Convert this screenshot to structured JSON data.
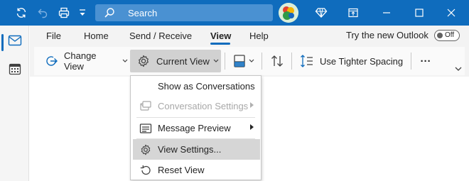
{
  "titlebar": {
    "search_placeholder": "Search",
    "icons": [
      "sync-icon",
      "undo-icon",
      "print-icon",
      "customize-qat-icon",
      "search-icon",
      "premium-diamond-icon",
      "restore-window-icon",
      "minimize-icon",
      "maximize-icon",
      "close-icon"
    ],
    "accent": "#0f6cbd"
  },
  "rail": {
    "items": [
      {
        "icon": "mail-icon",
        "selected": true
      },
      {
        "icon": "calendar-icon",
        "selected": false
      }
    ]
  },
  "ribbon": {
    "tabs": [
      {
        "label": "File"
      },
      {
        "label": "Home"
      },
      {
        "label": "Send / Receive"
      },
      {
        "label": "View",
        "active": true
      },
      {
        "label": "Help"
      }
    ],
    "try_new_outlook": "Try the new Outlook",
    "toggle_state": "Off",
    "buttons": {
      "change_view": "Change View",
      "current_view": "Current View",
      "tighter_spacing": "Use Tighter Spacing",
      "more": "···"
    }
  },
  "menu": {
    "items": [
      {
        "label": "Show as Conversations",
        "icon": "",
        "enabled": true,
        "submenu": false
      },
      {
        "label": "Conversation Settings",
        "icon": "conversation-settings-icon",
        "enabled": false,
        "submenu": true
      },
      {
        "label": "Message Preview",
        "icon": "message-preview-icon",
        "enabled": true,
        "submenu": true
      },
      {
        "label": "View Settings...",
        "icon": "gear-icon",
        "enabled": true,
        "submenu": false,
        "hovered": true
      },
      {
        "label": "Reset View",
        "icon": "reset-icon",
        "enabled": true,
        "submenu": false
      }
    ]
  }
}
